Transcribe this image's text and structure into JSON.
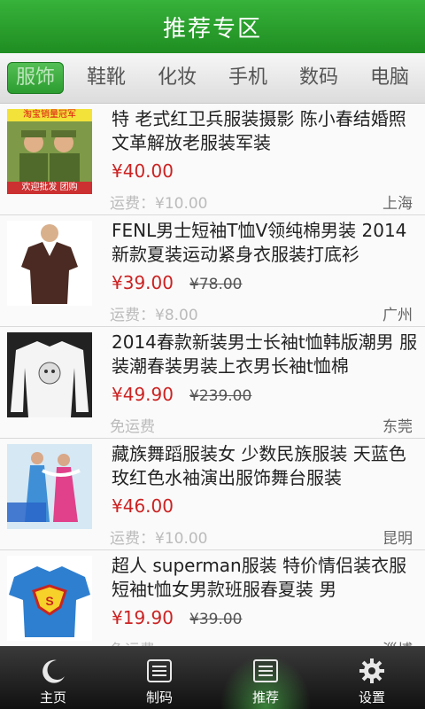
{
  "header": {
    "title": "推荐专区"
  },
  "tabs": [
    {
      "label": "服饰"
    },
    {
      "label": "鞋靴"
    },
    {
      "label": "化妆"
    },
    {
      "label": "手机"
    },
    {
      "label": "数码"
    },
    {
      "label": "电脑"
    }
  ],
  "items": [
    {
      "name": "特 老式红卫兵服装摄影 陈小春结婚照 文革解放老服装军装",
      "price": "¥40.00",
      "old_price": "",
      "shipping": "运费：¥10.00",
      "location": "上海",
      "thumb_top_text": "淘宝销量冠军",
      "thumb_bottom_text": "欢迎批发 团购"
    },
    {
      "name": "FENL男士短袖T恤V领纯棉男装 2014新款夏装运动紧身衣服装打底衫",
      "price": "¥39.00",
      "old_price": "¥78.00",
      "shipping": "运费：¥8.00",
      "location": "广州"
    },
    {
      "name": "2014春款新装男士长袖t恤韩版潮男 服装潮春装男装上衣男长袖t恤棉",
      "price": "¥49.90",
      "old_price": "¥239.00",
      "shipping": "免运费",
      "location": "东莞"
    },
    {
      "name": "藏族舞蹈服装女 少数民族服装 天蓝色 玫红色水袖演出服饰舞台服装",
      "price": "¥46.00",
      "old_price": "",
      "shipping": "运费：¥10.00",
      "location": "昆明"
    },
    {
      "name": "超人 superman服装 特价情侣装衣服 短袖t恤女男款班服春夏装 男",
      "price": "¥19.90",
      "old_price": "¥39.00",
      "shipping": "免运费",
      "location": "淄博"
    }
  ],
  "bottom_nav": [
    {
      "label": "主页",
      "icon": "moon-icon"
    },
    {
      "label": "制码",
      "icon": "barcode-card-icon"
    },
    {
      "label": "推荐",
      "icon": "list-card-icon"
    },
    {
      "label": "设置",
      "icon": "gear-icon"
    }
  ],
  "colors": {
    "header_green": "#2a9f2e",
    "price_red": "#cc2222",
    "active_tab": "#3bab3f"
  }
}
